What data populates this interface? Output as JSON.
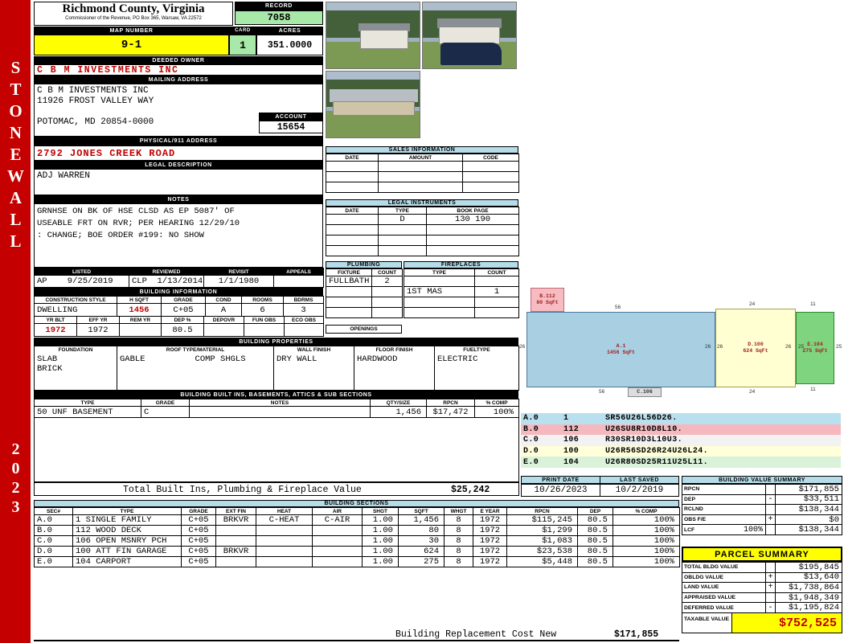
{
  "sidebar": {
    "district": "STONEWALL",
    "year": "2023"
  },
  "county": {
    "title": "Richmond County, Virginia",
    "subtitle": "Commissioner of the Revenue, PO Box 365, Warsaw, VA 22572"
  },
  "record": {
    "label": "RECORD",
    "value": "7058"
  },
  "map": {
    "label": "MAP NUMBER",
    "value": "9-1",
    "card_label": "CARD",
    "card_value": "1",
    "acres_label": "ACRES",
    "acres_value": "351.0000"
  },
  "owner": {
    "label": "DEEDED OWNER",
    "value": "C B M INVESTMENTS INC"
  },
  "mailing": {
    "label": "MAILING ADDRESS",
    "lines": [
      "C B M INVESTMENTS INC",
      "11926 FROST VALLEY WAY",
      "",
      "POTOMAC, MD 20854-0000"
    ]
  },
  "account": {
    "label": "ACCOUNT",
    "value": "15654"
  },
  "physical": {
    "label": "PHYSICAL/911 ADDRESS",
    "value": "2792 JONES CREEK ROAD"
  },
  "legal": {
    "label": "LEGAL DESCRIPTION",
    "value": "ADJ WARREN"
  },
  "notes": {
    "label": "NOTES",
    "lines": [
      "GRNHSE ON BK OF HSE CLSD AS EP 5087' OF",
      "USEABLE FRT ON RVR; PER HEARING 12/29/10",
      ": CHANGE; BOE ORDER #199: NO SHOW"
    ]
  },
  "review": {
    "headers": [
      "LISTED",
      "REVIEWED",
      "REVISIT",
      "APPEALS"
    ],
    "values": [
      "AP    9/25/2019",
      "CLP  1/13/2014",
      "1/1/1980",
      ""
    ]
  },
  "building_info": {
    "label": "BUILDING INFORMATION",
    "row1_headers": [
      "CONSTRUCTION STYLE",
      "H SQFT",
      "GRADE",
      "COND",
      "ROOMS",
      "BDRMS"
    ],
    "row1_values": [
      "DWELLING",
      "1456",
      "C+05",
      "A",
      "6",
      "3"
    ],
    "row2_headers": [
      "YR BLT",
      "EFF YR",
      "REM YR",
      "DEP %",
      "DEPOVR",
      "FUN OBS",
      "ECO OBS"
    ],
    "row2_values": [
      "1972",
      "1972",
      "",
      "80.5",
      "",
      "",
      ""
    ]
  },
  "building_props": {
    "label": "BUILDING PROPERTIES",
    "headers": [
      "FOUNDATION",
      "ROOF TYPE/MATERIAL",
      "WALL FINISH",
      "FLOOR FINISH",
      "FUELTYPE"
    ],
    "foundation": [
      "SLAB",
      "BRICK"
    ],
    "roof_type": "GABLE",
    "roof_material": "COMP SHGLS",
    "wall_finish": "DRY WALL",
    "floor_finish": "HARDWOOD",
    "fuel_type": "ELECTRIC"
  },
  "built_ins": {
    "label": "BUILDING BUILT INS, BASEMENTS, ATTICS & SUB SECTIONS",
    "headers": [
      "TYPE",
      "GRADE",
      "NOTES",
      "QTY/SIZE",
      "RPCN",
      "% COMP"
    ],
    "rows": [
      [
        "50 UNF BASEMENT",
        "C",
        "",
        "1,456",
        "$17,472",
        "100%"
      ]
    ],
    "total_label": "Total Built Ins, Plumbing & Fireplace Value",
    "total_value": "$25,242"
  },
  "sales": {
    "label": "SALES INFORMATION",
    "headers": [
      "DATE",
      "AMOUNT",
      "CODE"
    ],
    "rows": [
      [
        "",
        "",
        ""
      ],
      [
        "",
        "",
        ""
      ],
      [
        "",
        "",
        ""
      ]
    ]
  },
  "instruments": {
    "label": "LEGAL INSTRUMENTS",
    "headers": [
      "DATE",
      "TYPE",
      "BOOK PAGE"
    ],
    "rows": [
      [
        "",
        "D",
        "130 190"
      ],
      [
        "",
        "",
        ""
      ],
      [
        "",
        "",
        ""
      ],
      [
        "",
        "",
        ""
      ]
    ]
  },
  "plumbing": {
    "label": "PLUMBING",
    "headers": [
      "FIXTURE",
      "COUNT"
    ],
    "rows": [
      [
        "FULLBATH",
        "2"
      ],
      [
        "",
        ""
      ],
      [
        "",
        ""
      ],
      [
        "",
        ""
      ]
    ],
    "openings_label": "OPENINGS"
  },
  "fireplaces": {
    "label": "FIREPLACES",
    "headers": [
      "TYPE",
      "COUNT"
    ],
    "rows": [
      [
        "",
        ""
      ],
      [
        "1ST MAS",
        "1"
      ],
      [
        "",
        ""
      ],
      [
        "",
        ""
      ]
    ]
  },
  "sketch": {
    "shapes": {
      "a": {
        "name": "A.1",
        "size": "1456 SqFt"
      },
      "b": {
        "name": "B.112",
        "size": "80 SqFt"
      },
      "c": {
        "name": "C.106",
        "size": ""
      },
      "d": {
        "name": "D.100",
        "size": "624 SqFt"
      },
      "e": {
        "name": "E.104",
        "size": "275 SqFt"
      }
    },
    "dims": {
      "a_top": "56",
      "a_bottom": "56",
      "a_left": "26",
      "a_right": "26",
      "d_left": "26",
      "d_top": "24",
      "d_bottom": "24",
      "d_right": "26",
      "e_left": "25",
      "e_top": "11",
      "e_bottom": "11",
      "e_right": "25"
    },
    "legend": [
      {
        "sec": "A.0",
        "code": "1",
        "trace": "SR56U26L56D26.",
        "color": "#b9e0ee"
      },
      {
        "sec": "B.0",
        "code": "112",
        "trace": "U26SU8R10D8L10.",
        "color": "#f6b8bf"
      },
      {
        "sec": "C.0",
        "code": "106",
        "trace": "R30SR10D3L10U3.",
        "color": "#f2f2f2"
      },
      {
        "sec": "D.0",
        "code": "100",
        "trace": "U26R56SD26R24U26L24.",
        "color": "#ffffd9"
      },
      {
        "sec": "E.0",
        "code": "104",
        "trace": "U26R80SD25R11U25L11.",
        "color": "#d9f2d9"
      }
    ]
  },
  "print_info": {
    "print_label": "PRINT DATE",
    "print_value": "10/26/2023",
    "saved_label": "LAST SAVED",
    "saved_value": "10/2/2019"
  },
  "bvs": {
    "label": "BUILDING VALUE SUMMARY",
    "rows": [
      {
        "label": "RPCN",
        "extra": "",
        "op": "",
        "value": "$171,855"
      },
      {
        "label": "DEP",
        "extra": "",
        "op": "-",
        "value": "$33,511"
      },
      {
        "label": "RCLND",
        "extra": "",
        "op": "",
        "value": "$138,344"
      },
      {
        "label": "OBS F/E",
        "extra": "",
        "op": "+",
        "value": "$0"
      },
      {
        "label": "LCF",
        "extra": "100%",
        "op": "",
        "value": "$138,344"
      }
    ]
  },
  "sections": {
    "label": "BUILDING SECTIONS",
    "headers": [
      "SEC#",
      "TYPE",
      "GRADE",
      "EXT FIN",
      "HEAT",
      "AIR",
      "SHGT",
      "SQFT",
      "WHGT",
      "E YEAR",
      "RPCN",
      "DEP",
      "% COMP"
    ],
    "rows": [
      [
        "A.0",
        "1 SINGLE FAMILY",
        "C+05",
        "BRKVR",
        "C-HEAT",
        "C-AIR",
        "1.00",
        "1,456",
        "8",
        "1972",
        "$115,245",
        "80.5",
        "100%"
      ],
      [
        "B.0",
        "112 WOOD DECK",
        "C+05",
        "",
        "",
        "",
        "1.00",
        "80",
        "8",
        "1972",
        "$1,299",
        "80.5",
        "100%"
      ],
      [
        "C.0",
        "106 OPEN MSNRY PCH",
        "C+05",
        "",
        "",
        "",
        "1.00",
        "30",
        "8",
        "1972",
        "$1,083",
        "80.5",
        "100%"
      ],
      [
        "D.0",
        "100 ATT FIN GARAGE",
        "C+05",
        "BRKVR",
        "",
        "",
        "1.00",
        "624",
        "8",
        "1972",
        "$23,538",
        "80.5",
        "100%"
      ],
      [
        "E.0",
        "104 CARPORT",
        "C+05",
        "",
        "",
        "",
        "1.00",
        "275",
        "8",
        "1972",
        "$5,448",
        "80.5",
        "100%"
      ]
    ]
  },
  "parcel": {
    "label": "PARCEL SUMMARY",
    "rows": [
      {
        "label": "TOTAL BLDG VALUE",
        "op": "",
        "value": "$195,845"
      },
      {
        "label": "OBLDG VALUE",
        "op": "+",
        "value": "$13,640"
      },
      {
        "label": "LAND VALUE",
        "op": "+",
        "value": "$1,738,864"
      },
      {
        "label": "APPRAISED VALUE",
        "op": "",
        "value": "$1,948,349"
      },
      {
        "label": "DEFERRED VALUE",
        "op": "-",
        "value": "$1,195,824"
      }
    ],
    "taxable_label": "TAXABLE VALUE",
    "taxable_value": "$752,525"
  },
  "footer": {
    "label": "Building Replacement Cost New",
    "value": "$171,855"
  }
}
